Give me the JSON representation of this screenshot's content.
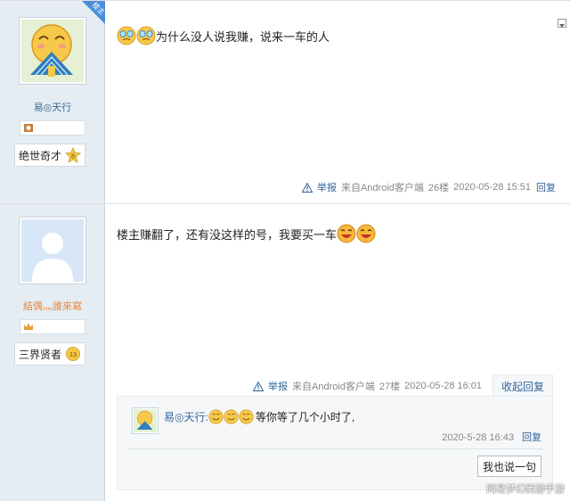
{
  "posts": [
    {
      "username": "易◎天行",
      "rank_title": "绝世奇才",
      "rank_level": "8",
      "owner_tag": "楼主",
      "text": "为什么没人说我赚，说来一车的人",
      "report_label": "举报",
      "source": "来自Android客户端",
      "floor": "26楼",
      "datetime": "2020-05-28 15:51",
      "reply_label": "回复"
    },
    {
      "username": "結偶灬誰來寫",
      "rank_title": "三界贤者",
      "rank_level": "13",
      "text": "楼主赚翻了，还有没这样的号，我要买一车",
      "report_label": "举报",
      "source": "来自Android客户端",
      "floor": "27楼",
      "datetime": "2020-05-28 16:01",
      "collapse_label": "收起回复",
      "sub_reply": {
        "username": "易◎天行:",
        "text": "等你等了几个小时了,",
        "datetime": "2020-5-28 16:43",
        "reply_label": "回复"
      },
      "say_button": "我也说一句"
    }
  ],
  "watermark": "网易梦幻西游手游",
  "colors": {
    "sidebar_bg": "#e5edf2",
    "link": "#336699",
    "meta_text": "#888888",
    "username2": "#e8853d"
  }
}
